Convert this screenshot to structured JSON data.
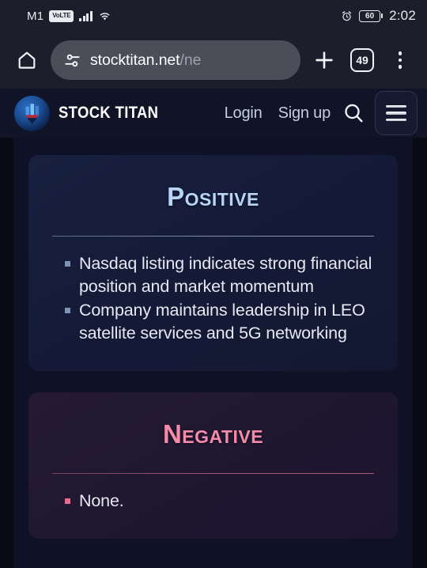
{
  "status_bar": {
    "carrier": "M1",
    "network_badge": "VoLTE",
    "signal_icon": "signal-bars-icon",
    "wifi_icon": "wifi-icon",
    "alarm_icon": "alarm-clock-icon",
    "battery_level": "60",
    "time": "2:02"
  },
  "browser": {
    "home_icon": "home-icon",
    "site_settings_icon": "tune-icon",
    "url_visible": "stocktitan.net",
    "url_path": "/ne",
    "new_tab_icon": "plus-icon",
    "tab_count": "49",
    "menu_icon": "kebab-menu-icon"
  },
  "site_header": {
    "logo_icon": "stock-titan-logo-icon",
    "brand": "STOCK TITAN",
    "login_label": "Login",
    "signup_label": "Sign up",
    "search_icon": "search-icon",
    "menu_icon": "hamburger-menu-icon"
  },
  "cards": [
    {
      "id": "positive",
      "title": "Positive",
      "accent": "#b8d4f5",
      "bullets": [
        "Nasdaq listing indicates strong financial position and market momentum",
        "Company maintains leadership in LEO satellite services and 5G networking"
      ]
    },
    {
      "id": "negative",
      "title": "Negative",
      "accent": "#f58ba8",
      "bullets": [
        "None."
      ]
    }
  ]
}
